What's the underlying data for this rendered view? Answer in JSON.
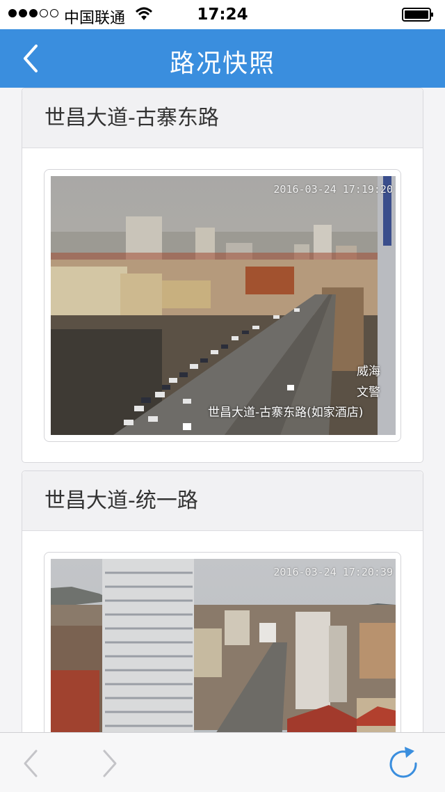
{
  "status_bar": {
    "carrier": "中国联通",
    "time": "17:24",
    "signal_bars": 3,
    "signal_total": 5,
    "icons": [
      "signal-dots-icon",
      "wifi-icon",
      "battery-icon"
    ]
  },
  "nav": {
    "title": "路况快照",
    "back_icon": "chevron-left-icon"
  },
  "cameras": [
    {
      "title": "世昌大道-古寨东路",
      "timestamp": "2016-03-24  17:19:20",
      "brand_line1": "威海",
      "brand_line2": "文警",
      "location_overlay": "世昌大道-古寨东路(如家酒店)"
    },
    {
      "title": "世昌大道-统一路",
      "timestamp": "2016-03-24  17:20:39"
    }
  ],
  "toolbar": {
    "icons": [
      "back-arrow-icon",
      "forward-arrow-icon",
      "refresh-icon"
    ]
  },
  "colors": {
    "nav_bar": "#3a8ede",
    "icon_blue": "#3a8ede",
    "toolbar_disabled": "#c4c4c8"
  }
}
